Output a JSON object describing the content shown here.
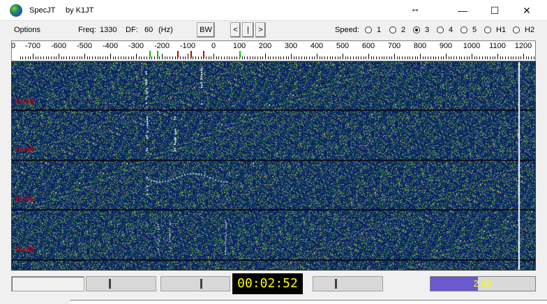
{
  "titlebar": {
    "app_name": "SpecJT",
    "author": "by K1JT",
    "resize_icon": "↔"
  },
  "toolbar": {
    "options_label": "Options",
    "freq_label": "Freq:",
    "freq_value": "1330",
    "df_label": "DF:",
    "df_value": "60",
    "df_unit": "(Hz)",
    "bw_label": "BW",
    "nav_left": "<",
    "nav_mid": "|",
    "nav_right": ">",
    "speed_label": "Speed:",
    "speed_options": [
      "1",
      "2",
      "3",
      "4",
      "5",
      "H1",
      "H2"
    ],
    "speed_selected": "3"
  },
  "scale": {
    "ticks": [
      "0",
      "-700",
      "-600",
      "-500",
      "-400",
      "-300",
      "-200",
      "-100",
      "0",
      "100",
      "200",
      "300",
      "400",
      "500",
      "600",
      "700",
      "800",
      "900",
      "1000",
      "1100",
      "1200"
    ],
    "markers": [
      {
        "value": -250,
        "color": "#00c000"
      },
      {
        "value": -220,
        "color": "#00c000"
      },
      {
        "value": -140,
        "color": "#cc0000"
      },
      {
        "value": -90,
        "color": "#cc0000"
      },
      {
        "value": -40,
        "color": "#cc0000"
      },
      {
        "value": 100,
        "color": "#00c000"
      }
    ]
  },
  "spectrum": {
    "band_times": [
      "00:54",
      "20:50",
      "14:41",
      "22:42"
    ],
    "colors": {
      "background": "#0a1d6b",
      "noise_green": "#2f8f3f",
      "noise_yellow": "#c8c850",
      "signal": "#ffffff",
      "band_line": "#0a0a1a"
    }
  },
  "bottom": {
    "clock": "00:02:52",
    "gain_label": "2 dB",
    "gain_fraction": 0.45
  }
}
